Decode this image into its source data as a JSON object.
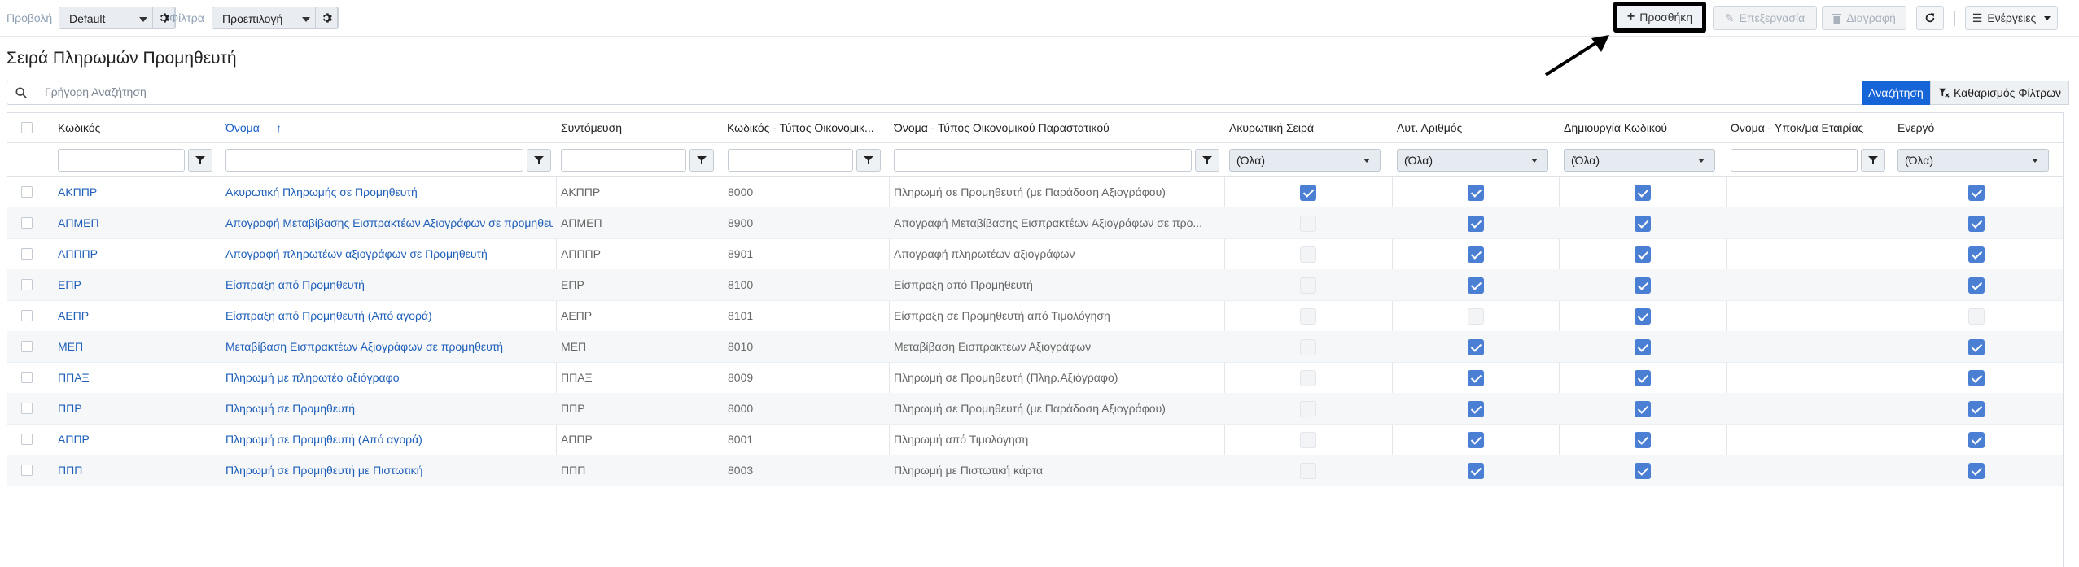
{
  "toolbar": {
    "view_label": "Προβολή",
    "view_value": "Default",
    "filters_label": "Φίλτρα",
    "filters_value": "Προεπιλογή",
    "add_label": "Προσθήκη",
    "edit_label": "Επεξεργασία",
    "delete_label": "Διαγραφή",
    "actions_label": "Ενέργειες"
  },
  "page": {
    "title": "Σειρά Πληρωμών Προμηθευτή"
  },
  "search": {
    "placeholder": "Γρήγορη Αναζήτηση",
    "search_button": "Αναζήτηση",
    "clear_button": "Καθαρισμός Φίλτρων"
  },
  "grid": {
    "columns": [
      "Κωδικός",
      "Όνομα",
      "Συντόμευση",
      "Κωδικός - Τύπος Οικονομικ...",
      "Όνομα - Τύπος Οικονομικού Παραστατικού",
      "Ακυρωτική Σειρά",
      "Αυτ. Αριθμός",
      "Δημιουργία Κωδικού",
      "Όνομα - Υποκ/μα Εταιρίας",
      "Ενεργό"
    ],
    "select_all_value": "(Όλα)",
    "rows": [
      {
        "code": "ΑΚΠΠΡ",
        "name": "Ακυρωτική Πληρωμής σε Προμηθευτή",
        "short": "ΑΚΠΠΡ",
        "doc_code": "8000",
        "doc_name": "Πληρωμή σε Προμηθευτή (με Παράδοση Αξιογράφου)",
        "cancel": true,
        "auto": true,
        "gen": true,
        "branch": "",
        "active": true
      },
      {
        "code": "ΑΠΜΕΠ",
        "name": "Απογραφή Μεταβίβασης Εισπρακτέων Αξιογράφων σε προμηθευτή",
        "short": "ΑΠΜΕΠ",
        "doc_code": "8900",
        "doc_name": "Απογραφή Μεταβίβασης Εισπρακτέων Αξιογράφων σε προ...",
        "cancel": false,
        "auto": true,
        "gen": true,
        "branch": "",
        "active": true
      },
      {
        "code": "ΑΠΠΠΡ",
        "name": "Απογραφή πληρωτέων αξιογράφων σε Προμηθευτή",
        "short": "ΑΠΠΠΡ",
        "doc_code": "8901",
        "doc_name": "Απογραφή πληρωτέων αξιογράφων",
        "cancel": false,
        "auto": true,
        "gen": true,
        "branch": "",
        "active": true
      },
      {
        "code": "ΕΠΡ",
        "name": "Είσπραξη από Προμηθευτή",
        "short": "ΕΠΡ",
        "doc_code": "8100",
        "doc_name": "Είσπραξη από Προμηθευτή",
        "cancel": false,
        "auto": true,
        "gen": true,
        "branch": "",
        "active": true
      },
      {
        "code": "ΑΕΠΡ",
        "name": "Είσπραξη από Προμηθευτή (Από αγορά)",
        "short": "ΑΕΠΡ",
        "doc_code": "8101",
        "doc_name": "Είσπραξη σε Προμηθευτή από Τιμολόγηση",
        "cancel": false,
        "auto": false,
        "gen": true,
        "branch": "",
        "active": false
      },
      {
        "code": "ΜΕΠ",
        "name": "Μεταβίβαση Εισπρακτέων Αξιογράφων σε προμηθευτή",
        "short": "ΜΕΠ",
        "doc_code": "8010",
        "doc_name": "Μεταβίβαση Εισπρακτέων Αξιογράφων",
        "cancel": false,
        "auto": true,
        "gen": true,
        "branch": "",
        "active": true
      },
      {
        "code": "ΠΠΑΞ",
        "name": "Πληρωμή με πληρωτέο αξιόγραφο",
        "short": "ΠΠΑΞ",
        "doc_code": "8009",
        "doc_name": "Πληρωμή σε Προμηθευτή (Πληρ.Αξιόγραφο)",
        "cancel": false,
        "auto": true,
        "gen": true,
        "branch": "",
        "active": true
      },
      {
        "code": "ΠΠΡ",
        "name": "Πληρωμή σε Προμηθευτή",
        "short": "ΠΠΡ",
        "doc_code": "8000",
        "doc_name": "Πληρωμή σε Προμηθευτή (με Παράδοση Αξιογράφου)",
        "cancel": false,
        "auto": true,
        "gen": true,
        "branch": "",
        "active": true
      },
      {
        "code": "ΑΠΠΡ",
        "name": "Πληρωμή σε Προμηθευτή (Από αγορά)",
        "short": "ΑΠΠΡ",
        "doc_code": "8001",
        "doc_name": "Πληρωμή από Τιμολόγηση",
        "cancel": false,
        "auto": true,
        "gen": true,
        "branch": "",
        "active": true
      },
      {
        "code": "ΠΠΠ",
        "name": "Πληρωμή σε Προμηθευτή με Πιστωτική",
        "short": "ΠΠΠ",
        "doc_code": "8003",
        "doc_name": "Πληρωμή με Πιστωτική κάρτα",
        "cancel": false,
        "auto": true,
        "gen": true,
        "branch": "",
        "active": true
      }
    ]
  },
  "colors": {
    "accent": "#1565d8",
    "link": "#1f5fb8",
    "checkbox": "#4a7fd4"
  },
  "icons": [
    "gear-icon",
    "plus-icon",
    "pencil-icon",
    "trash-icon",
    "refresh-icon",
    "hamburger-icon",
    "search-icon",
    "filter-icon",
    "filter-clear-icon",
    "sort-asc-icon",
    "arrow-annotation-icon"
  ]
}
